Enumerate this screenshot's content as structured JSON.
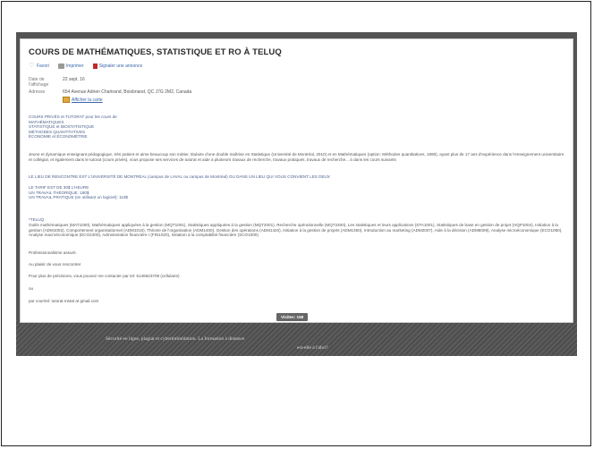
{
  "ad": {
    "title": "COURS DE MATHÉMATIQUES, STATISTIQUE ET RO À TELUQ",
    "actions": {
      "favorite": "Favori",
      "print": "Imprimer",
      "report": "Signaler une annonce"
    },
    "date_label": "Date de l'affichage",
    "date_value": "22 sept. 16",
    "address_label": "Adresse",
    "address_value": "654 Avenue Adrien Chartrand, Boisbriand, QC J7G 2M2, Canada",
    "map_link": "Afficher la carte",
    "intro_lines": [
      "COURS PRIVÉS et TUTORAT pour les cours de",
      "MATHÉMATIQUES",
      "STATISTIQUE et BIOSTATISTIQUE",
      "MÉTHODES QUANTITATIVES",
      "ÉCONOMIE et ÉCONOMÉTRIE"
    ],
    "bio": "Jeune et dynamique enseignant pédagogique, très patient et aime beaucoup son métier, titulaire d'une double maîtrise en Statistique (Université de Montréal, 2010) et en Mathématiques (option: Méthodes quantitatives, 1990), ayant plus de 17 ans d'expérience dans l'enseignement universitaire et collégial, et également dans le tutorat (cours privés), vous propose ses services de tutorat et aide à plusieurs travaux de recherche, travaux pratiques, travaux de recherche... à dans les cours suivants",
    "meeting_place": "LE LIEU DE RENCONTRE EST L'UNIVERSITÉ DE MONTRÉAL (campus de LAVAL ou campus de Montréal) OU DANS UN LIEU QUI VOUS CONVIENT LES DEUX",
    "rates": [
      "LE TARIF EST DE 30$ L'HEURE",
      "UN TRAVAIL THÉORIQUE: 180$",
      "UN TRAVAIL PRATIQUE (en utilisant un logiciel): 110$"
    ],
    "teluq_title": "*TELUQ",
    "teluq_courses": "Outils mathématiques (MAT1000), Mathématiques appliquées à la gestion (MQT1001), Statistiques appliquées à la gestion (MQT2001), Recherche opérationnelle (MQT2400), Les statistiques et leurs applications (STA1001), Statistiques de base en gestion de projet (HQP1004), Initiation à la gestion (ADM1002), Comportement organisationnel (ADM1010), Théorie de l'organisation (ADM1400), Gestion des opérations (ADM1420), Initiation à la gestion de projets (ADM1450), Introduction au marketing (ADM2007), Aide à la décision (ADM6009), Analyse microéconomique (ECO1060), Analyse macroéconomique (ECO2400), Administration financière I (FIN1020), Initiation à la comptabilité financière (SCO1000)",
    "professional_line": "Professionnalisme assuré.",
    "pleasure_line": "Au plaisir de vous rencontrer",
    "contact_line": "Pour plus de précisions, vous pouvez me contacter par tel: 5146623709 (cellulaire)",
    "or_line": "ou",
    "email_line": "par courriel: tutorat.mstat at gmail.com",
    "visits_label": "Visites: 158"
  },
  "slide_footer": {
    "line1": "Sécurité en ligne, plagiat et cyberintimidation.  La formation à distance",
    "line2": "est-elle à l'abri?"
  }
}
